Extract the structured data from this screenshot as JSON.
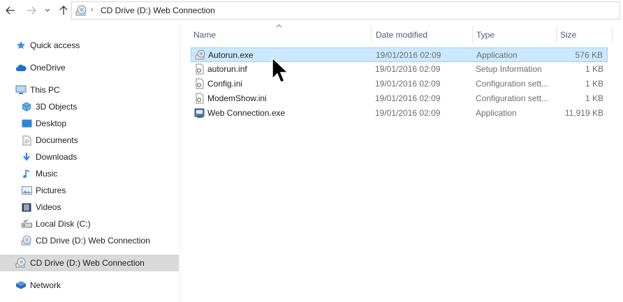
{
  "address_bar": {
    "path_text": "CD Drive (D:) Web Connection",
    "separator": "›"
  },
  "sidebar": {
    "items": [
      {
        "label": "Quick access",
        "icon": "star-icon"
      },
      {
        "label": "OneDrive",
        "icon": "cloud-icon"
      },
      {
        "label": "This PC",
        "icon": "computer-icon"
      },
      {
        "label": "3D Objects",
        "icon": "cube-icon"
      },
      {
        "label": "Desktop",
        "icon": "desktop-icon"
      },
      {
        "label": "Documents",
        "icon": "documents-icon"
      },
      {
        "label": "Downloads",
        "icon": "download-arrow-icon"
      },
      {
        "label": "Music",
        "icon": "music-note-icon"
      },
      {
        "label": "Pictures",
        "icon": "pictures-icon"
      },
      {
        "label": "Videos",
        "icon": "videos-icon"
      },
      {
        "label": "Local Disk (C:)",
        "icon": "drive-icon"
      },
      {
        "label": "CD Drive (D:) Web Connection",
        "icon": "cd-drive-icon"
      },
      {
        "label": "CD Drive (D:) Web Connection",
        "icon": "cd-drive-icon",
        "selected": true
      },
      {
        "label": "Network",
        "icon": "network-icon"
      }
    ]
  },
  "file_list": {
    "columns": {
      "name": "Name",
      "date": "Date modified",
      "type": "Type",
      "size": "Size"
    },
    "sort_indicator": "^",
    "rows": [
      {
        "name": "Autorun.exe",
        "date": "19/01/2016 02:09",
        "type": "Application",
        "size": "576 KB",
        "icon": "application-icon",
        "selected": true
      },
      {
        "name": "autorun.inf",
        "date": "19/01/2016 02:09",
        "type": "Setup Information",
        "size": "1 KB",
        "icon": "settings-file-icon"
      },
      {
        "name": "Config.ini",
        "date": "19/01/2016 02:09",
        "type": "Configuration sett...",
        "size": "1 KB",
        "icon": "settings-file-icon"
      },
      {
        "name": "ModemShow.ini",
        "date": "19/01/2016 02:09",
        "type": "Configuration sett...",
        "size": "1 KB",
        "icon": "settings-file-icon"
      },
      {
        "name": "Web Connection.exe",
        "date": "19/01/2016 02:09",
        "type": "Application",
        "size": "11,919 KB",
        "icon": "application-icon"
      }
    ]
  },
  "colors": {
    "selection_bg": "#cce8ff",
    "selection_border": "#99d1ff",
    "header_text": "#4c607a",
    "sidebar_selected_bg": "#d9d9d9"
  }
}
